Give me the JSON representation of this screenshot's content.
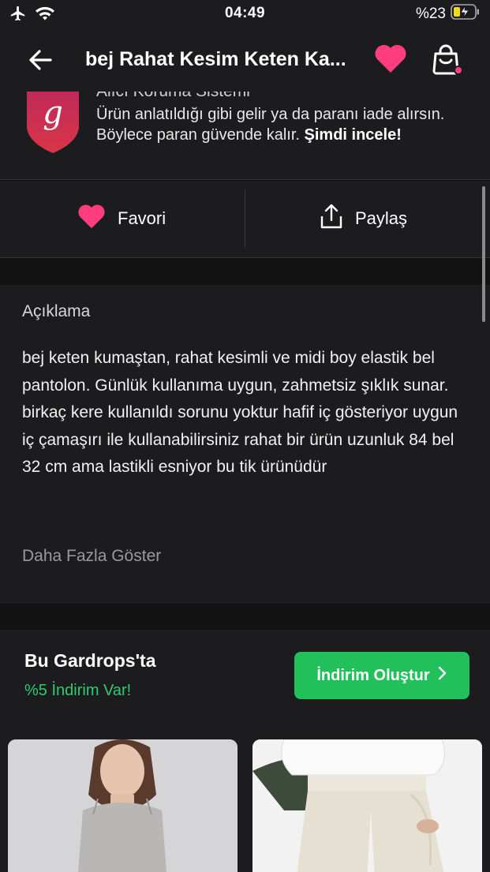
{
  "status_bar": {
    "time": "04:49",
    "battery": "%23",
    "icons": [
      "airplane-icon",
      "wifi-icon",
      "battery-charging-icon"
    ]
  },
  "nav": {
    "title": "bej Rahat Kesim Keten Ka...",
    "icons": [
      "back-arrow-icon",
      "heart-icon",
      "shopping-bag-icon"
    ],
    "accent_color": "#ff3d7f"
  },
  "trust": {
    "heading_partial": "Alıcı Koruma Sistemi",
    "text_prefix": "Ürün anlatıldığı gibi gelir ya da paranı iade alırsın. Böylece paran güvende kalır. ",
    "text_link": "Şimdi incele!",
    "logo_letter": "g"
  },
  "actions": {
    "favorite_label": "Favori",
    "share_label": "Paylaş"
  },
  "description": {
    "heading": "Açıklama",
    "body": "bej keten kumaştan, rahat kesimli ve midi boy elastik bel pantolon. Günlük kullanıma uygun, zahmetsiz şıklık sunar. birkaç kere kullanıldı sorunu yoktur hafif iç gösteriyor uygun iç çamaşırı ile kullanabilirsiniz rahat bir ürün uzunluk 84 bel 32 cm ama lastikli esniyor bu tik ürünüdür",
    "show_more": "Daha Fazla Göster"
  },
  "gardrops": {
    "title": "Bu Gardrops'ta",
    "discount": "%5 İndirim Var!",
    "cta_label": "İndirim Oluştur",
    "cta_color": "#21c05a",
    "discount_color": "#2ecc71"
  }
}
